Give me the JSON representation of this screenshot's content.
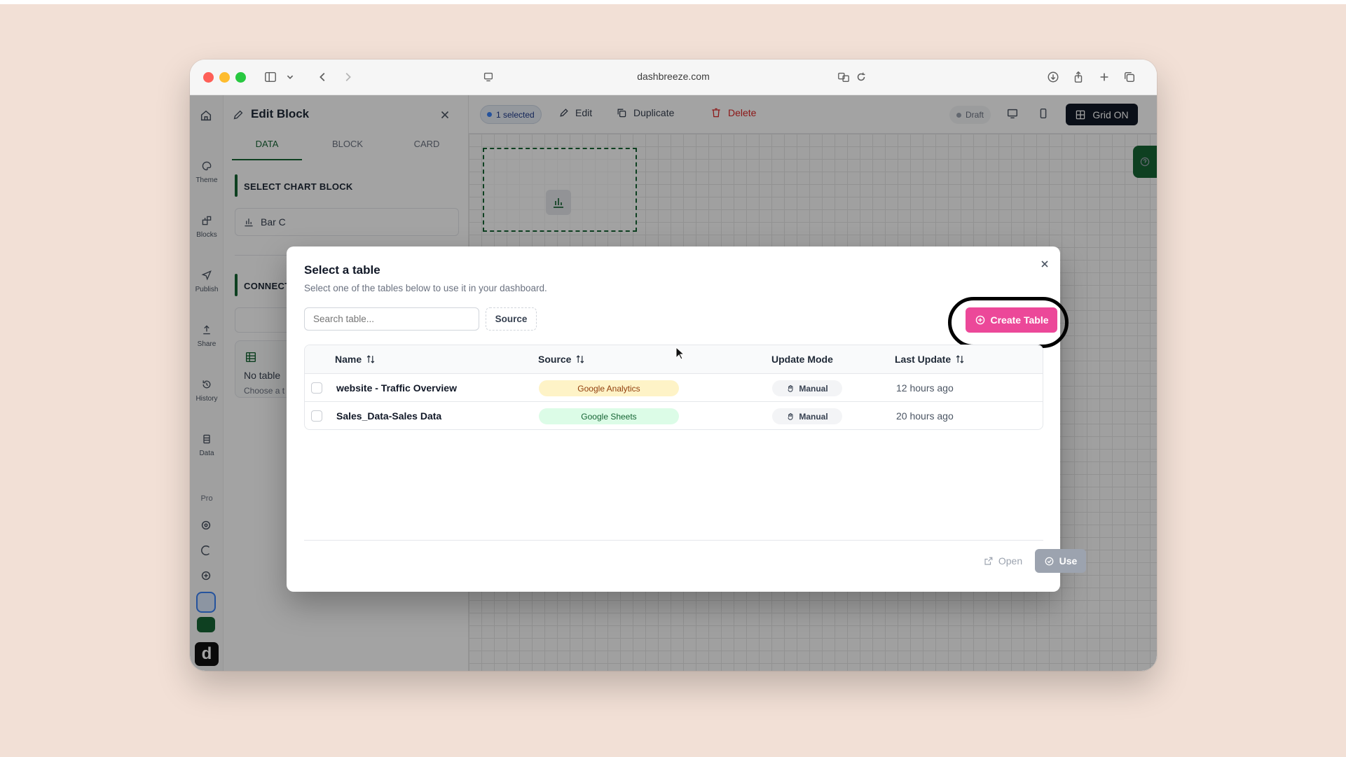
{
  "browser": {
    "url": "dashbreeze.com",
    "traffic_lights": [
      "#fe5f57",
      "#febc2e",
      "#28c840"
    ]
  },
  "rail": {
    "items": [
      {
        "label": "Theme"
      },
      {
        "label": "Blocks"
      },
      {
        "label": "Publish"
      },
      {
        "label": "Share"
      },
      {
        "label": "History"
      },
      {
        "label": "Data"
      }
    ],
    "pro_label": "Pro",
    "logo_letter": "d"
  },
  "edit_panel": {
    "title": "Edit Block",
    "tabs": [
      {
        "label": "DATA",
        "active": true
      },
      {
        "label": "BLOCK",
        "active": false
      },
      {
        "label": "CARD",
        "active": false
      }
    ],
    "select_chart_block": "SELECT CHART BLOCK",
    "chart_choice": "Bar C",
    "connect_label": "CONNECT",
    "no_table": "No table",
    "choose_hint": "Choose a t"
  },
  "toolbar": {
    "selected_label": "1 selected",
    "edit_label": "Edit",
    "duplicate_label": "Duplicate",
    "delete_label": "Delete",
    "draft_label": "Draft",
    "grid_label": "Grid ON"
  },
  "modal": {
    "title": "Select a table",
    "subtitle": "Select one of the tables below to use it in your dashboard.",
    "search_placeholder": "Search table...",
    "source_filter_label": "Source",
    "create_button_label": "Create Table",
    "columns": {
      "name": "Name",
      "source": "Source",
      "update_mode": "Update Mode",
      "last_update": "Last Update"
    },
    "rows": [
      {
        "name": "website - Traffic Overview",
        "source": "Google Analytics",
        "mode": "Manual",
        "updated": "12 hours ago"
      },
      {
        "name": "Sales_Data-Sales Data",
        "source": "Google Sheets",
        "mode": "Manual",
        "updated": "20 hours ago"
      }
    ],
    "open_label": "Open",
    "use_label": "Use"
  },
  "colors": {
    "accent_pink": "#ec4899",
    "brand_green": "#166534",
    "analytics_badge_bg": "#fef3c7",
    "analytics_badge_text": "#92400e",
    "sheets_badge_bg": "#dcfce7",
    "sheets_badge_text": "#166534"
  }
}
